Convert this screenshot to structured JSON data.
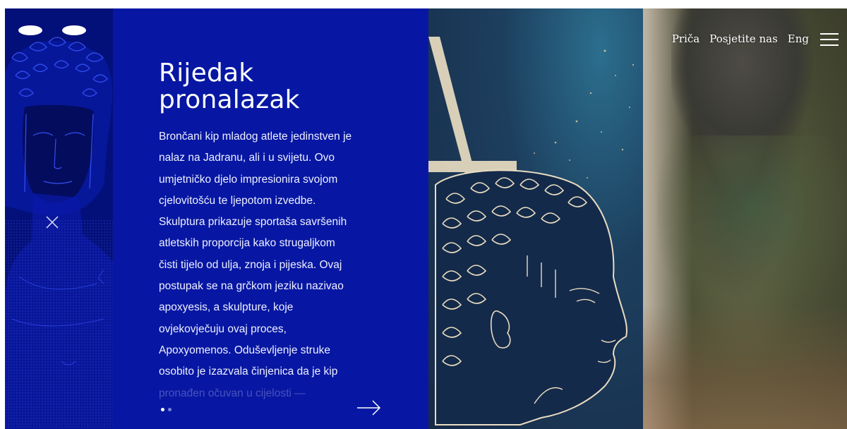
{
  "brand": {
    "logo_icon": "eyes-logo-icon"
  },
  "nav": {
    "items": [
      {
        "label": "Priča"
      },
      {
        "label": "Posjetite nas"
      },
      {
        "label": "Eng"
      }
    ],
    "menu_icon": "hamburger-menu-icon"
  },
  "panel": {
    "title_line1": "Rijedak",
    "title_line2": "pronalazak",
    "body_lines": [
      "Brončani kip mladog atlete jedinstven je",
      "nalaz na Jadranu, ali i u svijetu. Ovo",
      "umjetničko djelo impresionira svojom",
      "cjelovitošću te ljepotom izvedbe.",
      "Skulptura prikazuje sportaša savršenih",
      "atletskih proporcija kako strugaljkom",
      "čisti tijelo od ulja, znoja i pijeska. Ovaj",
      "postupak se na grčkom jeziku nazivao",
      "apoxyesis, a skulpture, koje",
      "ovjekovječuju ovaj proces,",
      "Apoxyomenos. Oduševljenje struke",
      "osobito je izazvala činjenica da je kip",
      "pronađen očuvan u cijelosti —"
    ],
    "pagination": {
      "current": 1,
      "total": 2
    },
    "next_icon": "arrow-right-icon",
    "close_icon": "close-icon"
  },
  "colors": {
    "panel_blue": "#0717a3",
    "strip_blue": "#04107a",
    "poster_teal": "#1d3f5e"
  }
}
